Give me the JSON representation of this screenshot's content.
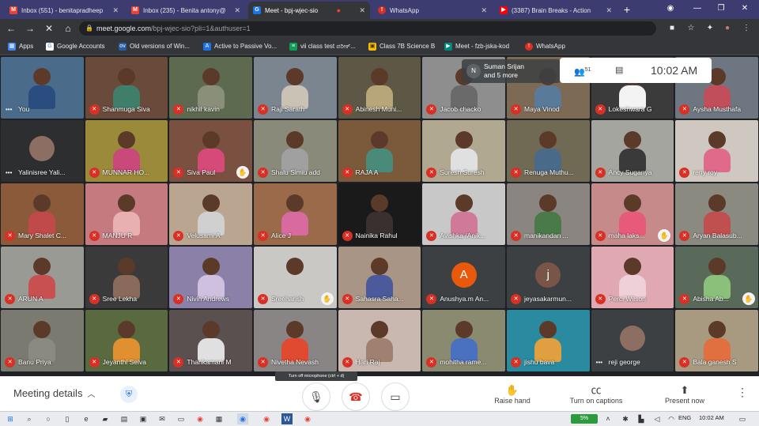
{
  "browser": {
    "tabs": [
      {
        "label": "Inbox (551) - benitapradheep",
        "icon": "gmail-icon",
        "active": false
      },
      {
        "label": "Inbox (235) - Benita antony@",
        "icon": "gmail-icon",
        "active": false
      },
      {
        "label": "Meet - bpj-wjec-sio",
        "icon": "meet-icon",
        "active": true
      },
      {
        "label": "WhatsApp",
        "icon": "whatsapp-icon",
        "active": false
      },
      {
        "label": "(3387) Brain Breaks - Action",
        "icon": "youtube-icon",
        "active": false
      }
    ],
    "url_host": "meet.google.com",
    "url_path": "/bpj-wjec-sio?pli=1&authuser=1",
    "bookmarks": [
      "Apps",
      "Google Accounts",
      "Old versions of Win...",
      "Active to Passive Vo...",
      "vii class test ಪರೀಕ್...",
      "Class 7B Science B",
      "Meet - fzb-jska-kod",
      "WhatsApp"
    ]
  },
  "meet": {
    "presenter_overlay": {
      "line1": "Suman Srijan",
      "line2": "and 5 more"
    },
    "participant_count": "51",
    "clock": "10:02  AM",
    "self_label": "You",
    "tiles": [
      {
        "name": "You",
        "muted": false,
        "dots": true,
        "bg": "#4a6b8a",
        "shirt": "#2b4c7e"
      },
      {
        "name": "Shanmuga Siva",
        "muted": true,
        "bg": "#6a4a3a",
        "shirt": "#3f7f6a"
      },
      {
        "name": "nikhil kavin",
        "muted": true,
        "bg": "#5e6a50",
        "shirt": "#8a8f7a"
      },
      {
        "name": "Raji Sarath",
        "muted": true,
        "bg": "#7a8590",
        "shirt": "#c9c2b5"
      },
      {
        "name": "Abinesh Muni...",
        "muted": true,
        "bg": "#5d5846",
        "shirt": "#b8a57a"
      },
      {
        "name": "Jacob chacko",
        "muted": true,
        "bg": "#8e8e8e",
        "shirt": "#6a6a6a"
      },
      {
        "name": "Maya Vinod",
        "muted": true,
        "bg": "#7d6a55",
        "shirt": "#5a7a9a"
      },
      {
        "name": "Lokeshwara G",
        "muted": true,
        "bg": "#3b3b3b",
        "shirt": "#f3f3f3"
      },
      {
        "name": "Aysha Musthafa",
        "muted": true,
        "bg": "#6d7681",
        "shirt": "#c04f5a"
      },
      {
        "name": "Yalinisree Yali...",
        "muted": false,
        "dots": true,
        "bg": "#2d2e30",
        "shirt": "#2d2e30",
        "avatar": true
      },
      {
        "name": "MUNNAR HO...",
        "muted": true,
        "bg": "#9a8a3a",
        "shirt": "#c94a7a"
      },
      {
        "name": "Siva Paul",
        "muted": true,
        "hand": true,
        "bg": "#7a5040",
        "shirt": "#d64a7a"
      },
      {
        "name": "Shalu Simiu add",
        "muted": true,
        "bg": "#8a8a7a",
        "shirt": "#a0a0a0"
      },
      {
        "name": "RAJA A",
        "muted": true,
        "bg": "#7a5a3a",
        "shirt": "#4a8a7a"
      },
      {
        "name": "Suresh Suresh",
        "muted": true,
        "bg": "#b0a890",
        "shirt": "#e0e0e0"
      },
      {
        "name": "Renuga Muthu...",
        "muted": true,
        "bg": "#706a55",
        "shirt": "#4a6a8a"
      },
      {
        "name": "Ancy Suganya",
        "muted": true,
        "bg": "#a5a5a0",
        "shirt": "#3a3a3a"
      },
      {
        "name": "reny roy",
        "muted": true,
        "bg": "#cfc8c0",
        "shirt": "#e06a8a"
      },
      {
        "name": "Mary Shalet C...",
        "muted": true,
        "bg": "#8a5a3a",
        "shirt": "#c04a4a"
      },
      {
        "name": "MANJU R",
        "muted": true,
        "bg": "#c57a80",
        "shirt": "#e8b0b0"
      },
      {
        "name": "Velusami A",
        "muted": true,
        "bg": "#b9a590",
        "shirt": "#d0d0d0"
      },
      {
        "name": "Alice J",
        "muted": true,
        "bg": "#9a6a4a",
        "shirt": "#d86aa0"
      },
      {
        "name": "Nainika Rahul",
        "muted": true,
        "bg": "#1a1a1a",
        "shirt": "#3a3030"
      },
      {
        "name": "Avishka /Anik...",
        "muted": true,
        "bg": "#c8c8c8",
        "shirt": "#d07a9a"
      },
      {
        "name": "manikandan ...",
        "muted": true,
        "bg": "#8a8580",
        "shirt": "#4a7a4a"
      },
      {
        "name": "maha laks...",
        "muted": true,
        "hand": true,
        "bg": "#c78a8a",
        "shirt": "#e85a7a"
      },
      {
        "name": "Aryan Balasub...",
        "muted": true,
        "bg": "#8a8a80",
        "shirt": "#c05050"
      },
      {
        "name": "ARUN A",
        "muted": true,
        "bg": "#9a9a95",
        "shirt": "#c85050"
      },
      {
        "name": "Sree Lekha",
        "muted": true,
        "bg": "#3a3a3a",
        "shirt": "#8a6a5a"
      },
      {
        "name": "Nivin Andrews",
        "muted": true,
        "bg": "#8a80a8",
        "shirt": "#d0c0e0"
      },
      {
        "name": "Sreeharish",
        "muted": true,
        "hand": true,
        "bg": "#cac8c5",
        "shirt": "#cac8c5"
      },
      {
        "name": "Sahasra Saha...",
        "muted": true,
        "bg": "#a89585",
        "shirt": "#4a5a9a"
      },
      {
        "name": "Anushya.m An...",
        "muted": true,
        "bg": "#3c4043",
        "shirt": "#3c4043",
        "letter": "A",
        "letter_bg": "#e8590c"
      },
      {
        "name": "jeyasakarmun...",
        "muted": true,
        "bg": "#3c4043",
        "shirt": "#3c4043",
        "letter": "j",
        "letter_bg": "#795548"
      },
      {
        "name": "Perci Wilson",
        "muted": true,
        "bg": "#e0a8b0",
        "shirt": "#f0d0d8"
      },
      {
        "name": "Abisha Ab...",
        "muted": true,
        "hand": true,
        "bg": "#5a6a5a",
        "shirt": "#8ac07a"
      },
      {
        "name": "Banu Priya",
        "muted": true,
        "bg": "#7a7a70",
        "shirt": "#8a8a80"
      },
      {
        "name": "Jeyanthi Selva",
        "muted": true,
        "bg": "#5a6a40",
        "shirt": "#e09030"
      },
      {
        "name": "Thankamani M",
        "muted": true,
        "bg": "#5a5050",
        "shirt": "#e0e0e0"
      },
      {
        "name": "Nivetha Nevash",
        "muted": true,
        "bg": "#8a8585",
        "shirt": "#e04a30"
      },
      {
        "name": "Hari Raj",
        "muted": true,
        "bg": "#c8b8b0",
        "shirt": "#a08070"
      },
      {
        "name": "mohitha rame...",
        "muted": true,
        "bg": "#8a8a70",
        "shirt": "#4a70c0"
      },
      {
        "name": "jishu bava",
        "muted": true,
        "bg": "#2a8aa0",
        "shirt": "#e0a040"
      },
      {
        "name": "reji george",
        "muted": false,
        "dots": true,
        "bg": "#3c4043",
        "shirt": "#3c4043",
        "avatar": true
      },
      {
        "name": "Bala ganesh S",
        "muted": true,
        "bg": "#a89a80",
        "shirt": "#e07040"
      }
    ],
    "bottom": {
      "meeting_details": "Meeting details",
      "tooltip": "Turn off microphone (ctrl + d)",
      "raise_hand": "Raise hand",
      "captions": "Turn on captions",
      "present": "Present now"
    }
  },
  "taskbar": {
    "battery": "5%",
    "language": "ENG",
    "time": "10:02 AM"
  }
}
